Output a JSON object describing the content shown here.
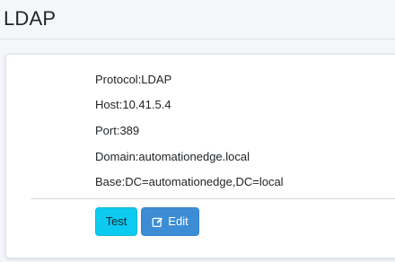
{
  "page": {
    "title": "LDAP"
  },
  "details": {
    "protocol": "Protocol:LDAP",
    "host": "Host:10.41.5.4",
    "port": "Port:389",
    "domain": "Domain:automationedge.local",
    "base": "Base:DC=automationedge,DC=local"
  },
  "actions": {
    "test_label": "Test",
    "edit_label": "Edit",
    "edit_icon": "edit-icon"
  },
  "colors": {
    "test_button": "#0dcaf0",
    "edit_button": "#3c8dd4"
  }
}
